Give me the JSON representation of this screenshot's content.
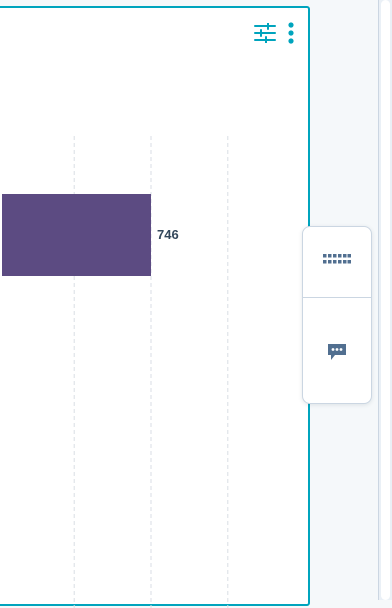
{
  "colors": {
    "accent": "#00a4bd",
    "bar": "#5c4b82",
    "grid": "#d9dee4",
    "label": "#33475b",
    "icon": "#516f90"
  },
  "toolbar": {
    "filter_icon": "filter-sliders-icon",
    "more_icon": "more-vertical-icon"
  },
  "side_dock": {
    "apps_icon": "apps-grid-icon",
    "chat_icon": "chat-bubble-icon"
  },
  "chart_data": {
    "type": "bar",
    "orientation": "horizontal",
    "values": [
      746
    ],
    "data_labels": [
      "746"
    ],
    "grid": true
  }
}
